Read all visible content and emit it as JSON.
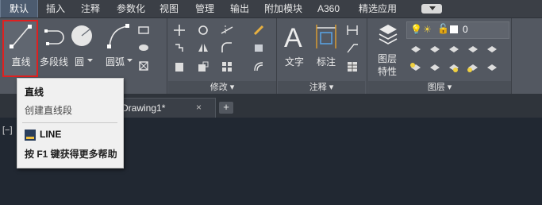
{
  "menu_tabs": [
    {
      "label": "默认",
      "active": true
    },
    {
      "label": "插入"
    },
    {
      "label": "注释"
    },
    {
      "label": "参数化"
    },
    {
      "label": "视图"
    },
    {
      "label": "管理"
    },
    {
      "label": "输出"
    },
    {
      "label": "附加模块"
    },
    {
      "label": "A360"
    },
    {
      "label": "精选应用"
    }
  ],
  "ribbon": {
    "draw": {
      "line": "直线",
      "polyline": "多段线",
      "circle": "圆",
      "arc": "圆弧"
    },
    "modify": {
      "title": "修改"
    },
    "annotation": {
      "title": "注释",
      "text": "文字",
      "dimension": "标注"
    },
    "layers": {
      "title": "图层",
      "properties_line1": "图层",
      "properties_line2": "特性",
      "layer_value": "0"
    }
  },
  "doc_tab": {
    "name": "Drawing1*",
    "close": "×",
    "new": "+"
  },
  "canvas": {
    "viewport_label": "[−]"
  },
  "tooltip": {
    "title": "直线",
    "description": "创建直线段",
    "command": "LINE",
    "help": "按 F1 键获得更多帮助"
  },
  "colors": {
    "accent_red": "#e02020",
    "ribbon_bg": "#535861",
    "menubar_bg": "#3b3f46",
    "canvas_bg": "#212832"
  }
}
